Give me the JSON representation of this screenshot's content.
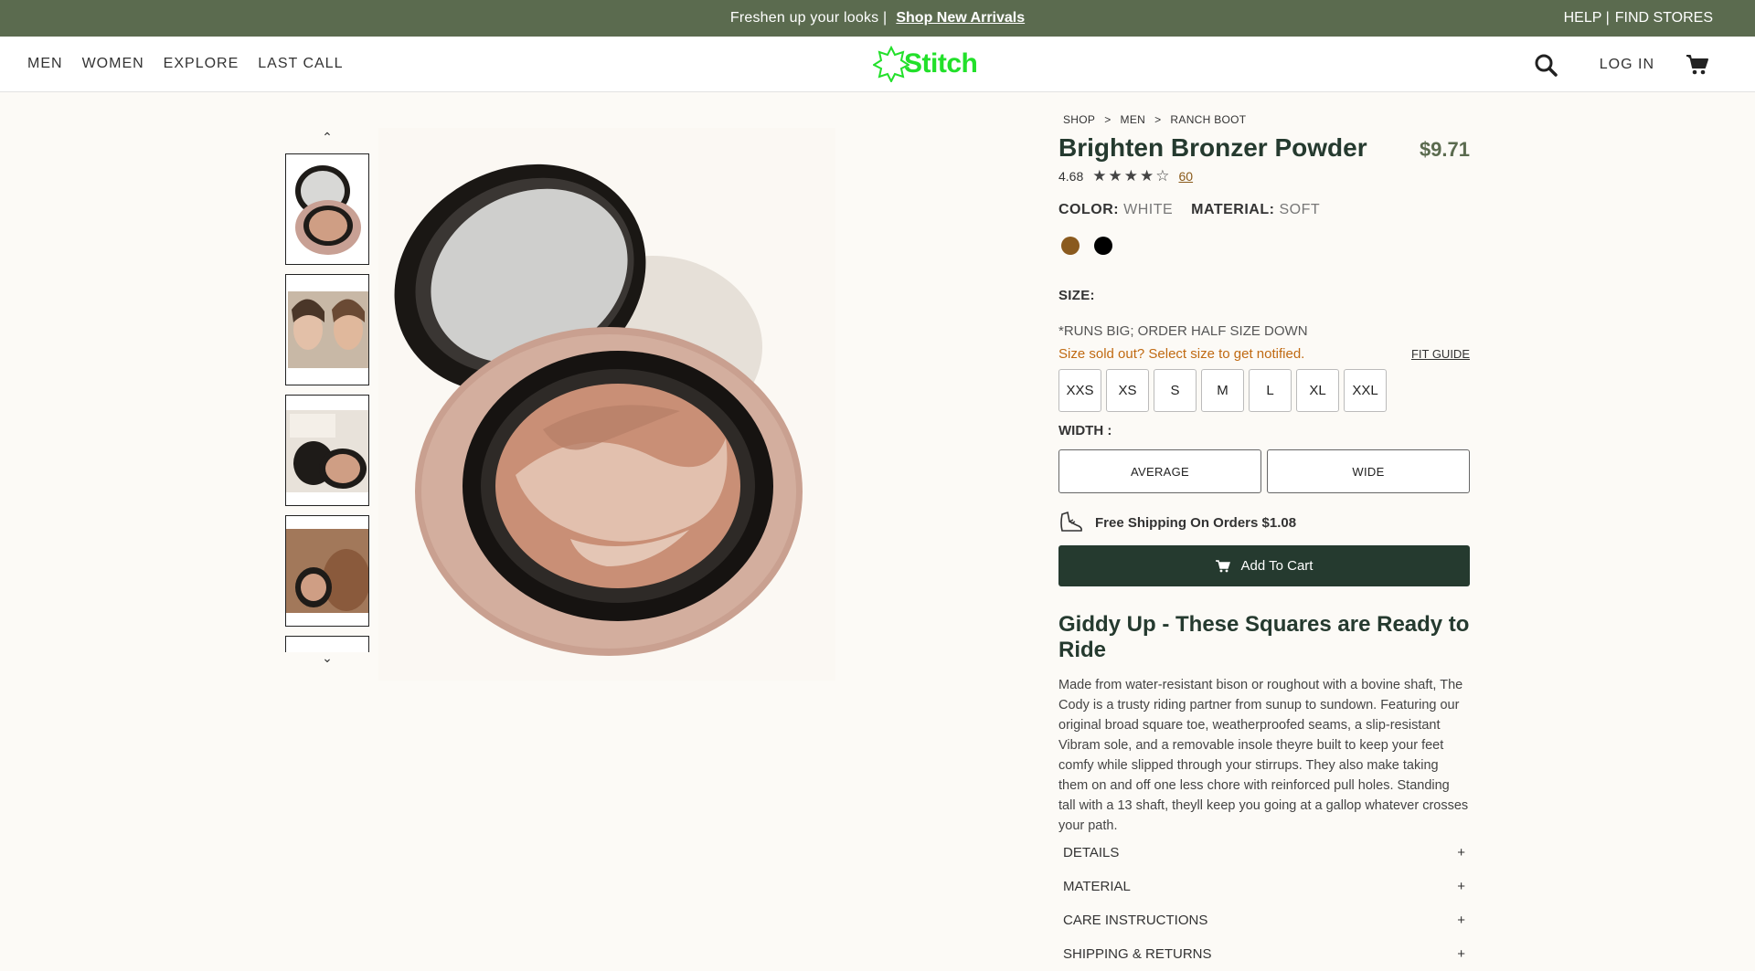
{
  "announce": {
    "message": "Freshen up your looks |",
    "link": "Shop New Arrivals",
    "help": "HELP |",
    "find_stores": "FIND STORES"
  },
  "nav": {
    "items": [
      "MEN",
      "WOMEN",
      "EXPLORE",
      "LAST CALL"
    ]
  },
  "brand": {
    "name": "Stitch",
    "color": "#22e02a"
  },
  "header": {
    "login": "LOG IN"
  },
  "breadcrumb": [
    "SHOP",
    ">",
    "MEN",
    ">",
    "RANCH BOOT"
  ],
  "product": {
    "title": "Brighten Bronzer Powder",
    "price": "$9.71",
    "rating": "4.68",
    "rating_stars": 4,
    "review_count": "60",
    "color_label": "COLOR:",
    "color_value": "WHITE",
    "material_label": "MATERIAL:",
    "material_value": "SOFT",
    "swatches": [
      "#8a5a1e",
      "#000000"
    ],
    "size_label": "SIZE:",
    "runs_note": "*RUNS BIG; ORDER HALF SIZE DOWN",
    "sold_out_note": "Size sold out? Select size to get notified.",
    "fit_guide": "FIT GUIDE",
    "sizes": [
      "XXS",
      "XS",
      "S",
      "M",
      "L",
      "XL",
      "XXL"
    ],
    "width_label": "WIDTH :",
    "widths": [
      "AVERAGE",
      "WIDE"
    ],
    "shipping": "Free Shipping On Orders $1.08",
    "add_to_cart": "Add To Cart",
    "desc_heading": "Giddy Up - These Squares are Ready to Ride",
    "description": "Made from water-resistant bison or roughout with a bovine shaft, The Cody is a trusty riding partner from sunup to sundown. Featuring our original broad square toe, weatherproofed seams, a slip-resistant Vibram sole, and a removable insole theyre built to keep your feet comfy while slipped through your stirrups. They also make taking them on and off one less chore with reinforced pull holes. Standing tall with a 13 shaft, theyll keep you going at a gallop whatever crosses your path.",
    "accordions": [
      {
        "label": "DETAILS",
        "sign": "+"
      },
      {
        "label": "MATERIAL",
        "sign": "+"
      },
      {
        "label": "CARE INSTRUCTIONS",
        "sign": "+"
      },
      {
        "label": "SHIPPING & RETURNS",
        "sign": "+"
      }
    ]
  },
  "colors": {
    "announce_bg": "#5b6b4f",
    "cart_bg": "#253a2f",
    "sold_out": "#c06a12",
    "price": "#5b6b4f"
  }
}
